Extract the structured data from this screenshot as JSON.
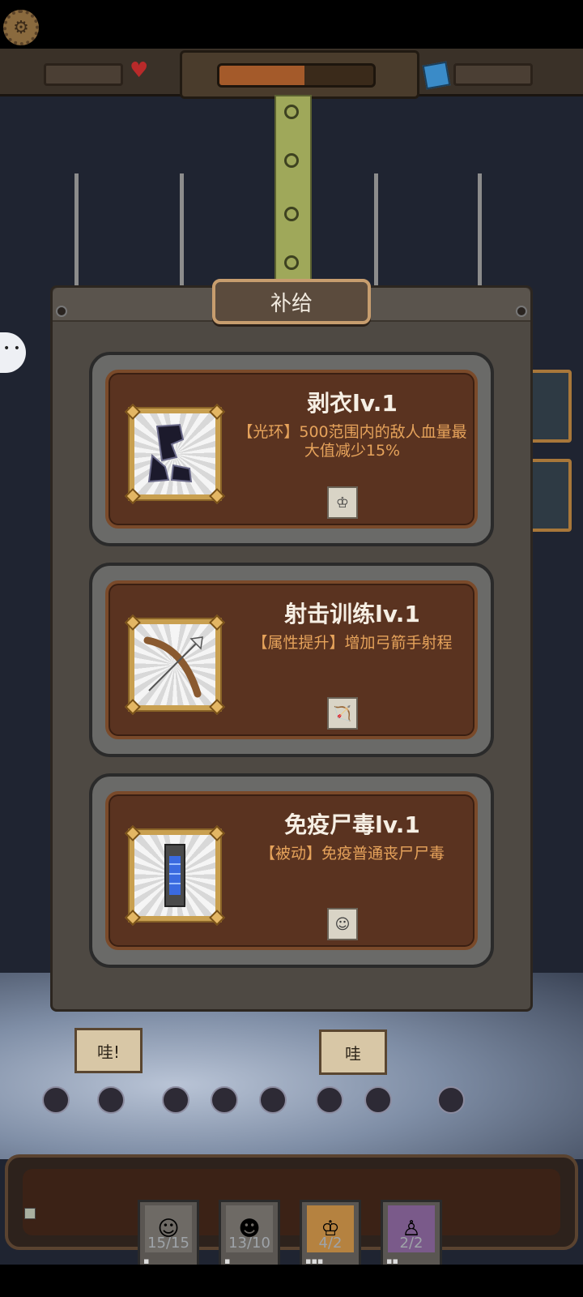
{
  "hud": {
    "settings_icon": "gear-icon",
    "life_icon": "heart-icon",
    "gem_icon": "cube-icon",
    "wave_progress": 0.55
  },
  "scene": {
    "bubble_left": "哇!",
    "bubble_right": "哇"
  },
  "modal": {
    "title": "补给",
    "options": [
      {
        "title": "剥衣lv.1",
        "description": "【光环】500范围内的敌人血量最大值减少15%",
        "icon": "boots-icon",
        "unit_icon": "king-unit-icon"
      },
      {
        "title": "射击训练lv.1",
        "description": "【属性提升】增加弓箭手射程",
        "icon": "bow-icon",
        "unit_icon": "archer-unit-icon"
      },
      {
        "title": "免疫尸毒lv.1",
        "description": "【被动】免疫普通丧尸尸毒",
        "icon": "vial-icon",
        "unit_icon": "soldier-unit-icon"
      }
    ]
  },
  "units": [
    {
      "count": "15/15",
      "icon": "soldier-unit-icon"
    },
    {
      "count": "13/10",
      "icon": "archer-unit-icon"
    },
    {
      "count": "4/2",
      "icon": "king-unit-icon"
    },
    {
      "count": "2/2",
      "icon": "mage-unit-icon"
    }
  ]
}
